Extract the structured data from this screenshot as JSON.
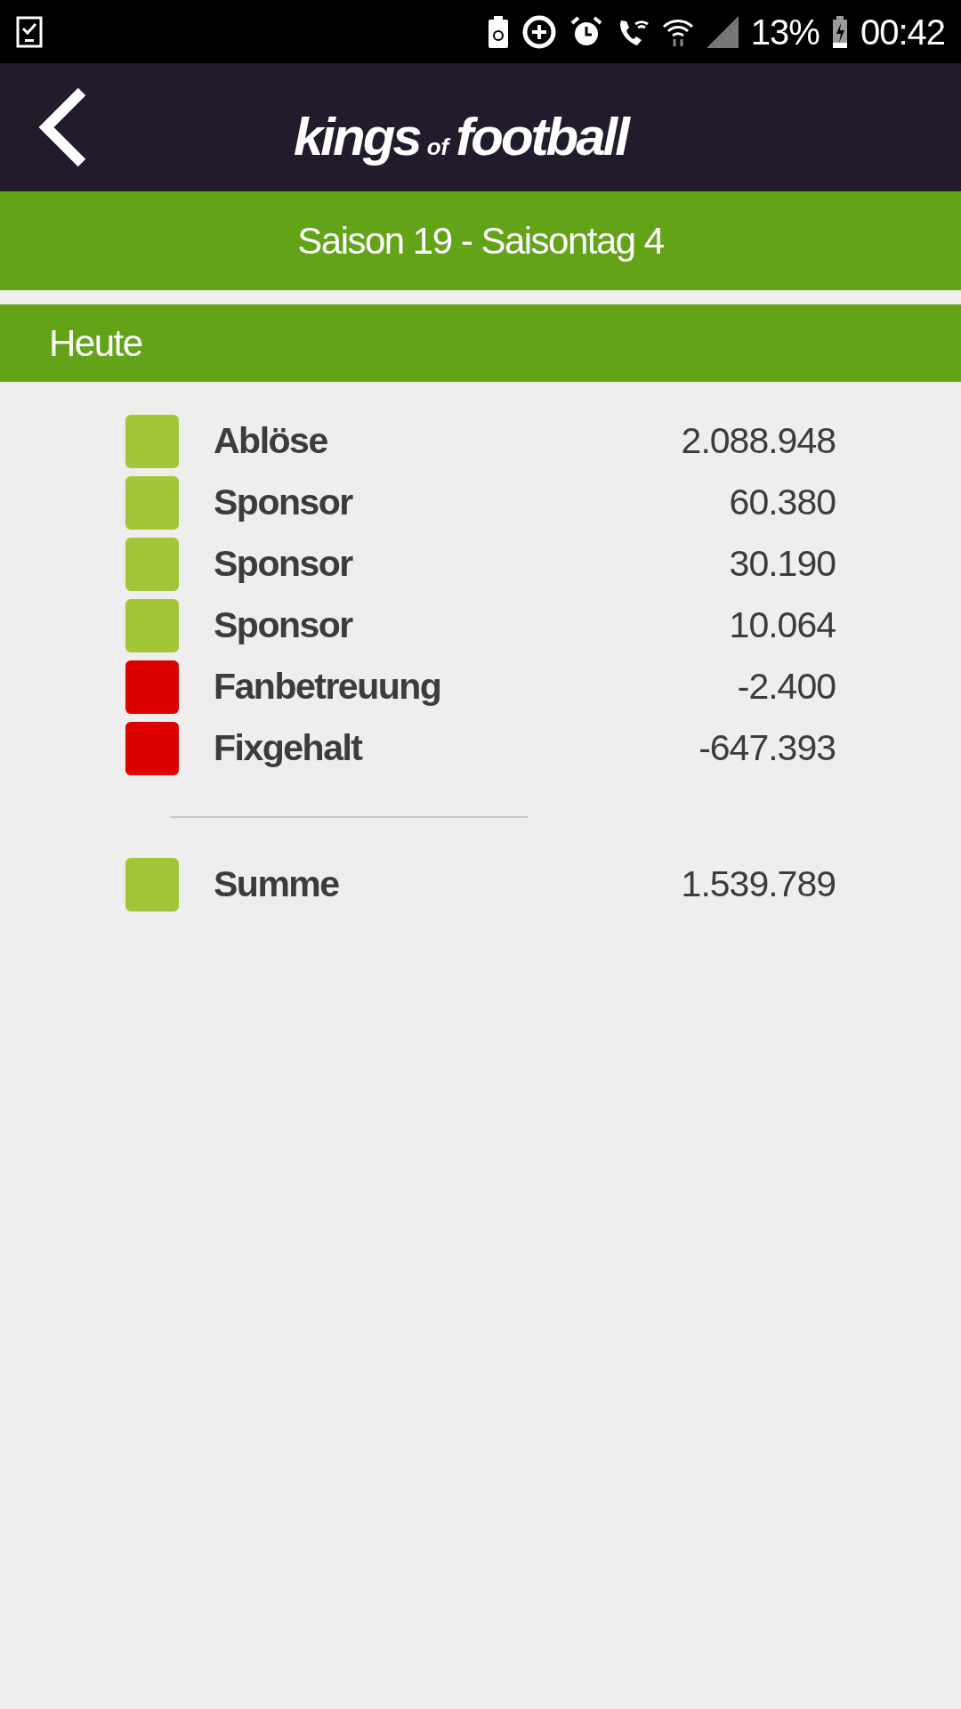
{
  "status_bar": {
    "battery_percent": "13%",
    "time": "00:42"
  },
  "header": {
    "logo": [
      "kings",
      "of",
      "football"
    ]
  },
  "season_bar": {
    "title": "Saison 19 - Saisontag 4"
  },
  "section": {
    "title": "Heute"
  },
  "entries": [
    {
      "label": "Ablöse",
      "value": "2.088.948",
      "color": "#a1c637"
    },
    {
      "label": "Sponsor",
      "value": "60.380",
      "color": "#a1c637"
    },
    {
      "label": "Sponsor",
      "value": "30.190",
      "color": "#a1c637"
    },
    {
      "label": "Sponsor",
      "value": "10.064",
      "color": "#a1c637"
    },
    {
      "label": "Fanbetreuung",
      "value": "-2.400",
      "color": "#dc0000"
    },
    {
      "label": "Fixgehalt",
      "value": "-647.393",
      "color": "#dc0000"
    }
  ],
  "total": {
    "label": "Summe",
    "value": "1.539.789",
    "color": "#a1c637"
  }
}
